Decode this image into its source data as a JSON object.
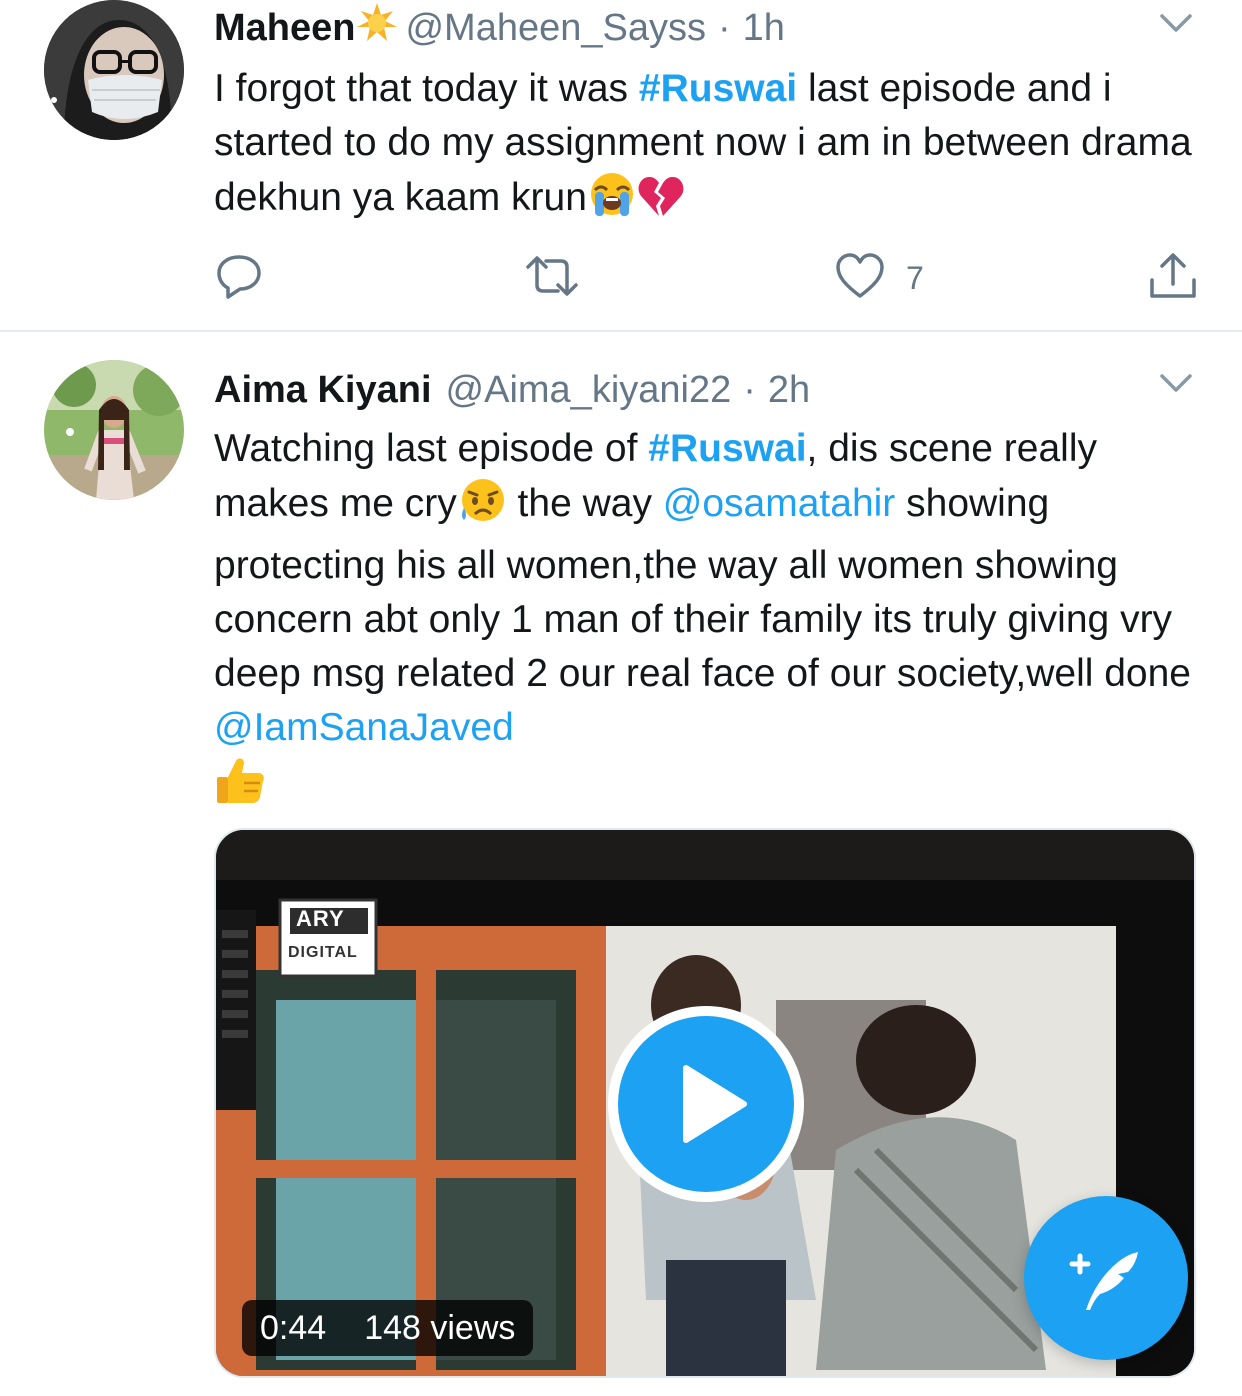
{
  "colors": {
    "accent": "#1da1f2",
    "secondary_text": "#657786",
    "divider": "#e6ecf0"
  },
  "tweets": [
    {
      "author": "Maheen",
      "author_badge_icon": "sun-emoji",
      "handle": "@Maheen_Sayss",
      "separator": "·",
      "time": "1h",
      "text_parts": {
        "p1": "I forgot that today it was ",
        "tag": "#Ruswai",
        "p2": "  last episode and i started to do my assignment now i am in between drama dekhun ya kaam krun"
      },
      "emojis": [
        "loudly-crying-face",
        "broken-heart"
      ],
      "actions": {
        "reply_icon": "reply-icon",
        "retweet_icon": "retweet-icon",
        "like_icon": "heart-icon",
        "like_count": "7",
        "share_icon": "share-icon"
      }
    },
    {
      "author": "Aima Kiyani",
      "handle": "@Aima_kiyani22",
      "separator": "·",
      "time": "2h",
      "text_parts": {
        "p1": "Watching last episode of ",
        "tag": "#Ruswai",
        "p2": ", dis scene really makes me cry",
        "p3": " the way ",
        "mention1": "@osamatahir",
        "p4": " showing protecting his all women,the way all women showing concern abt only 1 man of their family its truly giving vry deep msg related 2 our real face of our society,well done ",
        "mention2": "@IamSanaJaved"
      },
      "emojis": [
        "sad-but-relieved-face",
        "thumbs-up"
      ],
      "media": {
        "type": "video",
        "channel_logo_top": "ARY",
        "channel_logo_bottom": "DIGITAL",
        "duration": "0:44",
        "views": "148 views",
        "play_icon": "play-icon"
      }
    }
  ],
  "compose_button": {
    "icon": "compose-tweet-icon"
  }
}
